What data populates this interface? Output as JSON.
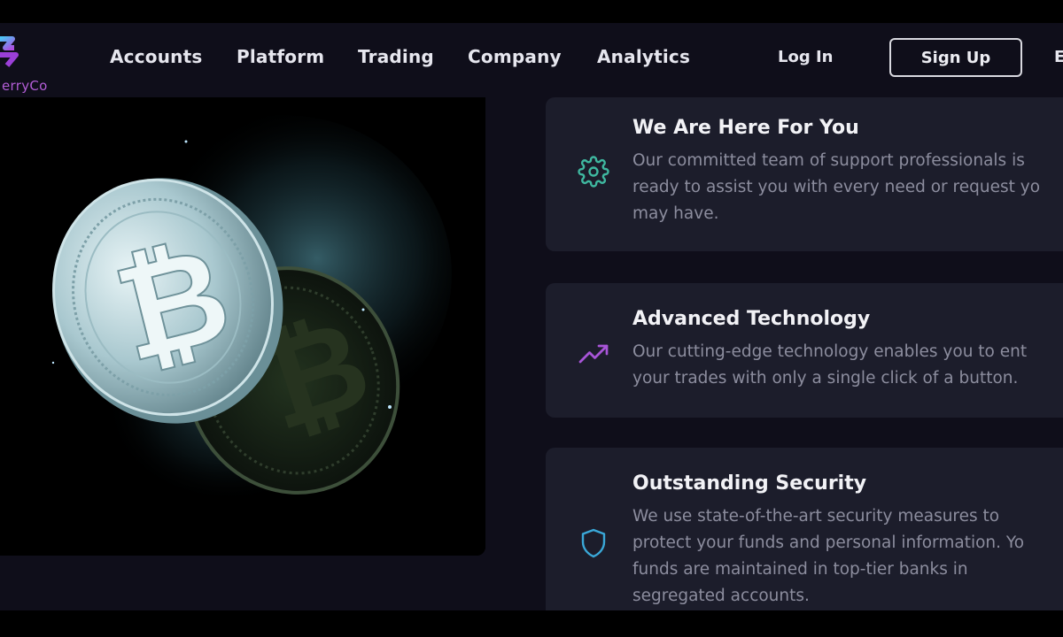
{
  "brand": {
    "logo_text": "erryCo"
  },
  "nav": {
    "links": [
      "Accounts",
      "Platform",
      "Trading",
      "Company",
      "Analytics"
    ],
    "login": "Log In",
    "signup": "Sign Up",
    "lang": "E"
  },
  "features": [
    {
      "title": "We Are Here For You",
      "desc": "Our committed team of support professionals is\nready to assist you with every need or request yo\nmay have.",
      "icon": "gear-icon",
      "icon_color": "#3fb8a0"
    },
    {
      "title": "Advanced Technology",
      "desc": "Our cutting-edge technology enables you to ent\nyour trades with only a single click of a button.",
      "icon": "trend-up-icon",
      "icon_color": "#a855d8"
    },
    {
      "title": "Outstanding Security",
      "desc": "We use state-of-the-art security measures to\nprotect your funds and personal information. Yo\nfunds are maintained in top-tier banks in\nsegregated accounts.",
      "icon": "shield-icon",
      "icon_color": "#3aa8d8"
    }
  ],
  "colors": {
    "background": "#0f0e1a",
    "card": "#1c1d2b",
    "accent_purple": "#a855d8",
    "accent_teal": "#3fb8a0"
  }
}
